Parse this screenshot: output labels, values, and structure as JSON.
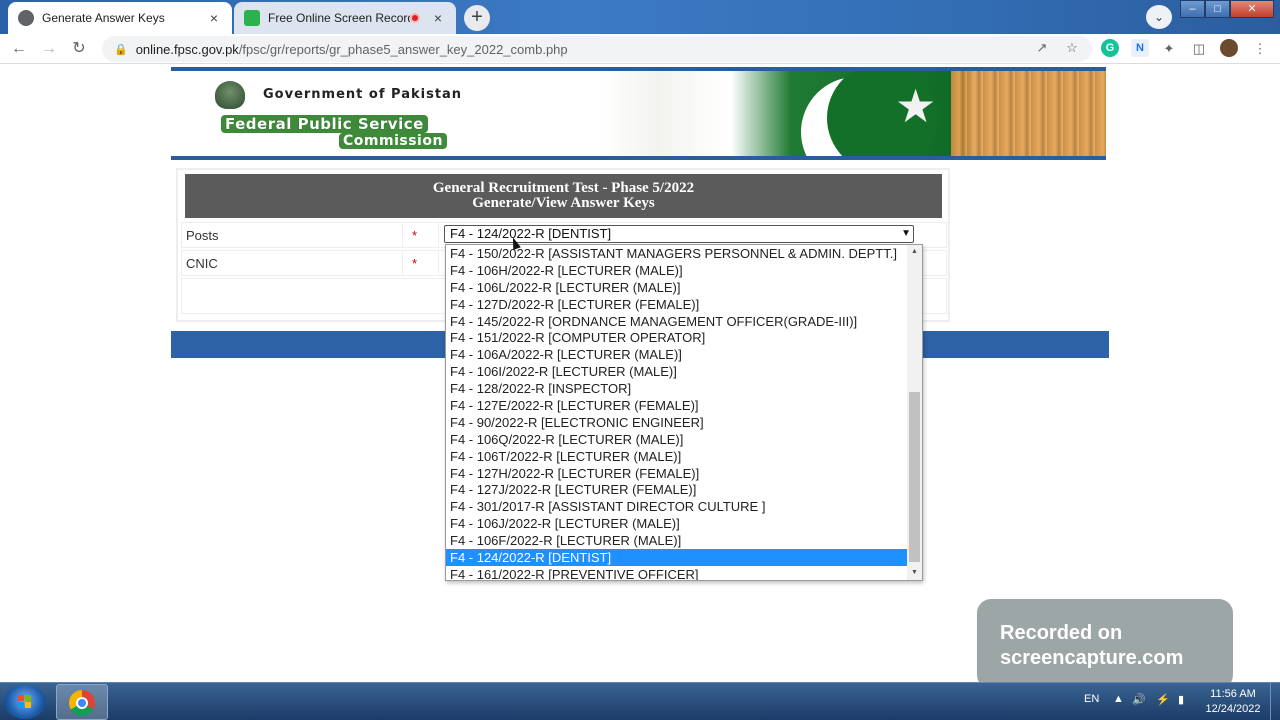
{
  "browser": {
    "tabs": [
      {
        "title": "Generate Answer Keys",
        "active": true
      },
      {
        "title": "Free Online Screen Recorder",
        "active": false,
        "recording": true
      }
    ],
    "new_tab_symbol": "+",
    "address": {
      "domain": "online.fpsc.gov.pk",
      "path": "/fpsc/gr/reports/gr_phase5_answer_key_2022_comb.php"
    },
    "icons": [
      "back-icon",
      "forward-icon",
      "reload-icon",
      "lock-icon",
      "share-icon",
      "star-icon",
      "grammarly-icon",
      "extension-n-icon",
      "puzzle-icon",
      "sidepanel-icon",
      "profile-avatar"
    ],
    "close_symbol": "×",
    "ext_g": "G",
    "ext_n": "N"
  },
  "header": {
    "gov_text": "Government of Pakistan",
    "fpsc_line1": "Federal Public Service",
    "fpsc_line2": "Commission"
  },
  "form": {
    "title_line1": "General Recruitment Test - Phase 5/2022",
    "title_line2": "Generate/View Answer Keys",
    "posts_label": "Posts",
    "cnic_label": "CNIC",
    "required_mark": "*",
    "selected_post": "F4 - 124/2022-R [DENTIST]"
  },
  "dropdown": {
    "options": [
      "F4 - 150/2022-R [ASSISTANT MANAGERS PERSONNEL & ADMIN. DEPTT.]",
      "F4 - 106H/2022-R [LECTURER (MALE)]",
      "F4 - 106L/2022-R [LECTURER (MALE)]",
      "F4 - 127D/2022-R [LECTURER (FEMALE)]",
      "F4 - 145/2022-R [ORDNANCE MANAGEMENT OFFICER(GRADE-III)]",
      "F4 - 151/2022-R [COMPUTER OPERATOR]",
      "F4 - 106A/2022-R [LECTURER (MALE)]",
      "F4 - 106I/2022-R [LECTURER (MALE)]",
      "F4 - 128/2022-R [INSPECTOR]",
      "F4 - 127E/2022-R [LECTURER (FEMALE)]",
      "F4 - 90/2022-R [ELECTRONIC ENGINEER]",
      "F4 - 106Q/2022-R [LECTURER (MALE)]",
      "F4 - 106T/2022-R [LECTURER (MALE)]",
      "F4 - 127H/2022-R [LECTURER (FEMALE)]",
      "F4 - 127J/2022-R [LECTURER (FEMALE)]",
      "F4 - 301/2017-R [ASSISTANT DIRECTOR CULTURE ]",
      "F4 - 106J/2022-R [LECTURER (MALE)]",
      "F4 - 106F/2022-R [LECTURER (MALE)]",
      "F4 - 124/2022-R [DENTIST]",
      "F4 - 161/2022-R [PREVENTIVE OFFICER]"
    ],
    "selected_index": 18
  },
  "watermark": {
    "line1": "Recorded on",
    "line2": "screencapture.com"
  },
  "taskbar": {
    "language": "EN",
    "time": "11:56 AM",
    "date": "12/24/2022"
  },
  "colors": {
    "header_bar": "#5b5b5b",
    "blue_bar": "#2d62a6",
    "selected_option": "#1e90ff"
  }
}
